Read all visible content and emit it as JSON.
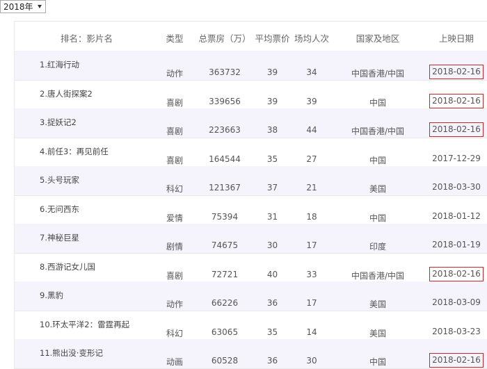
{
  "year_select": {
    "value": "2018年"
  },
  "table": {
    "headers": {
      "title": "排名：影片名",
      "type": "类型",
      "box": "总票房（万）",
      "price": "平均票价",
      "avg": "场均人次",
      "region": "国家及地区",
      "date": "上映日期"
    },
    "rows": [
      {
        "title": "1.红海行动",
        "type": "动作",
        "box": "363732",
        "price": "39",
        "avg": "34",
        "region": "中国香港/中国",
        "date": "2018-02-16"
      },
      {
        "title": "2.唐人街探案2",
        "type": "喜剧",
        "box": "339656",
        "price": "39",
        "avg": "39",
        "region": "中国",
        "date": "2018-02-16"
      },
      {
        "title": "3.捉妖记2",
        "type": "喜剧",
        "box": "223663",
        "price": "38",
        "avg": "44",
        "region": "中国香港/中国",
        "date": "2018-02-16"
      },
      {
        "title": "4.前任3：再见前任",
        "type": "喜剧",
        "box": "164544",
        "price": "35",
        "avg": "27",
        "region": "中国",
        "date": "2017-12-29"
      },
      {
        "title": "5.头号玩家",
        "type": "科幻",
        "box": "121367",
        "price": "37",
        "avg": "21",
        "region": "美国",
        "date": "2018-03-30"
      },
      {
        "title": "6.无问西东",
        "type": "爱情",
        "box": "75394",
        "price": "31",
        "avg": "18",
        "region": "中国",
        "date": "2018-01-12"
      },
      {
        "title": "7.神秘巨星",
        "type": "剧情",
        "box": "74675",
        "price": "30",
        "avg": "17",
        "region": "印度",
        "date": "2018-01-19"
      },
      {
        "title": "8.西游记女儿国",
        "type": "喜剧",
        "box": "72721",
        "price": "40",
        "avg": "33",
        "region": "中国香港/中国",
        "date": "2018-02-16"
      },
      {
        "title": "9.黑豹",
        "type": "动作",
        "box": "66226",
        "price": "36",
        "avg": "17",
        "region": "美国",
        "date": "2018-03-09"
      },
      {
        "title": "10.环太平洋2：雷霆再起",
        "type": "科幻",
        "box": "63065",
        "price": "35",
        "avg": "14",
        "region": "美国",
        "date": "2018-03-23"
      },
      {
        "title": "11.熊出没·变形记",
        "type": "动画",
        "box": "60528",
        "price": "36",
        "avg": "30",
        "region": "中国",
        "date": "2018-02-16"
      }
    ]
  },
  "highlight_color": "#c62828",
  "alt_row_color": "#f5f3fb"
}
